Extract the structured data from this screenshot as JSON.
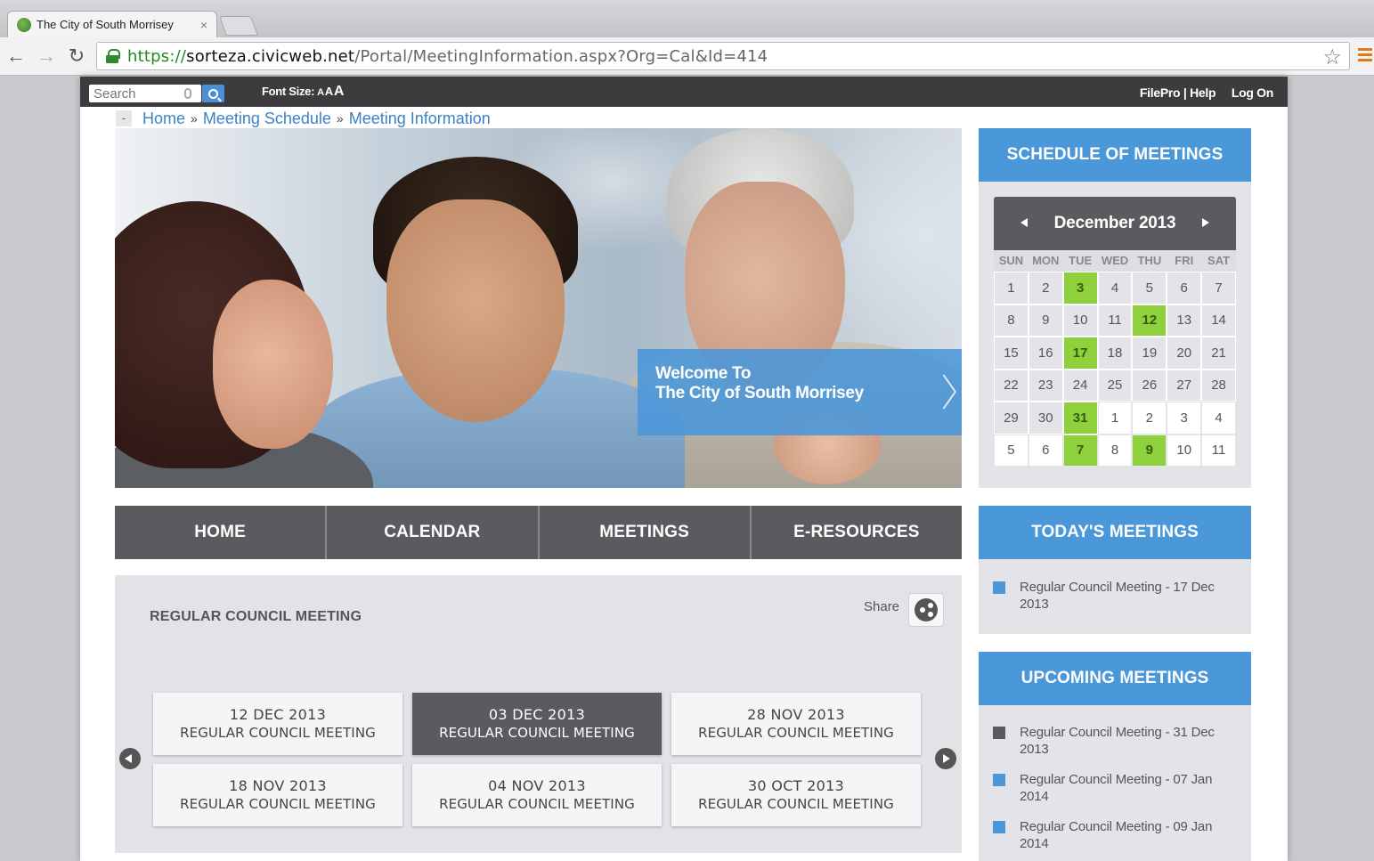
{
  "browser": {
    "tab_title": "The City of South Morrisey",
    "tab_close": "×",
    "url_scheme": "https://",
    "url_host": "sorteza.civicweb.net",
    "url_path": "/Portal/MeetingInformation.aspx?Org=Cal&Id=414",
    "back_icon": "←",
    "forward_icon": "→",
    "reload_icon": "↻",
    "star_icon": "☆"
  },
  "topbar": {
    "search_placeholder": "Search",
    "font_size_label": "Font Size:",
    "font_size_options": [
      "A",
      "A",
      "A"
    ],
    "links": [
      "FilePro | Help",
      "Log On"
    ]
  },
  "breadcrumb": {
    "collapse": "-",
    "items": [
      "Home",
      "Meeting Schedule",
      "Meeting Information"
    ],
    "separator": "»"
  },
  "hero": {
    "welcome_line1": "Welcome To",
    "welcome_line2": "The City of South Morrisey"
  },
  "main_nav": [
    "HOME",
    "CALENDAR",
    "MEETINGS",
    "E-RESOURCES"
  ],
  "meeting": {
    "title": "REGULAR COUNCIL MEETING",
    "share_label": "Share",
    "cards": [
      {
        "date": "12 DEC 2013",
        "name": "REGULAR COUNCIL MEETING",
        "active": false
      },
      {
        "date": "03 DEC 2013",
        "name": "REGULAR COUNCIL MEETING",
        "active": true
      },
      {
        "date": "28 NOV 2013",
        "name": "REGULAR COUNCIL MEETING",
        "active": false
      },
      {
        "date": "18 NOV 2013",
        "name": "REGULAR COUNCIL MEETING",
        "active": false
      },
      {
        "date": "04 NOV 2013",
        "name": "REGULAR COUNCIL MEETING",
        "active": false
      },
      {
        "date": "30 OCT 2013",
        "name": "REGULAR COUNCIL MEETING",
        "active": false
      }
    ]
  },
  "sidebar": {
    "schedule_title": "SCHEDULE OF MEETINGS",
    "calendar": {
      "month_label": "December 2013",
      "days_of_week": [
        "SUN",
        "MON",
        "TUE",
        "WED",
        "THU",
        "FRI",
        "SAT"
      ],
      "weeks": [
        [
          "1",
          "2",
          "3",
          "4",
          "5",
          "6",
          "7"
        ],
        [
          "8",
          "9",
          "10",
          "11",
          "12",
          "13",
          "14"
        ],
        [
          "15",
          "16",
          "17",
          "18",
          "19",
          "20",
          "21"
        ],
        [
          "22",
          "23",
          "24",
          "25",
          "26",
          "27",
          "28"
        ],
        [
          "29",
          "30",
          "31",
          "1",
          "2",
          "3",
          "4"
        ],
        [
          "5",
          "6",
          "7",
          "8",
          "9",
          "10",
          "11"
        ]
      ],
      "meeting_days": [
        "0-2",
        "1-4",
        "2-2",
        "4-2",
        "5-2",
        "5-4"
      ],
      "out_of_month": [
        "4-3",
        "4-4",
        "4-5",
        "4-6",
        "5-0",
        "5-1",
        "5-2",
        "5-3",
        "5-4",
        "5-5",
        "5-6"
      ]
    },
    "todays_title": "TODAY'S MEETINGS",
    "todays": [
      {
        "text": "Regular Council Meeting - 17 Dec 2013",
        "color": "#4a97da"
      }
    ],
    "upcoming_title": "UPCOMING MEETINGS",
    "upcoming": [
      {
        "text": "Regular Council Meeting - 31 Dec 2013",
        "color": "#5a5b5e"
      },
      {
        "text": "Regular Council Meeting - 07 Jan 2014",
        "color": "#4a97da"
      },
      {
        "text": "Regular Council Meeting - 09 Jan 2014",
        "color": "#4a97da"
      }
    ]
  },
  "colors": {
    "accent_blue": "#4a97da",
    "dark_gray": "#5a5b5e",
    "meeting_green": "#8fd13c"
  }
}
